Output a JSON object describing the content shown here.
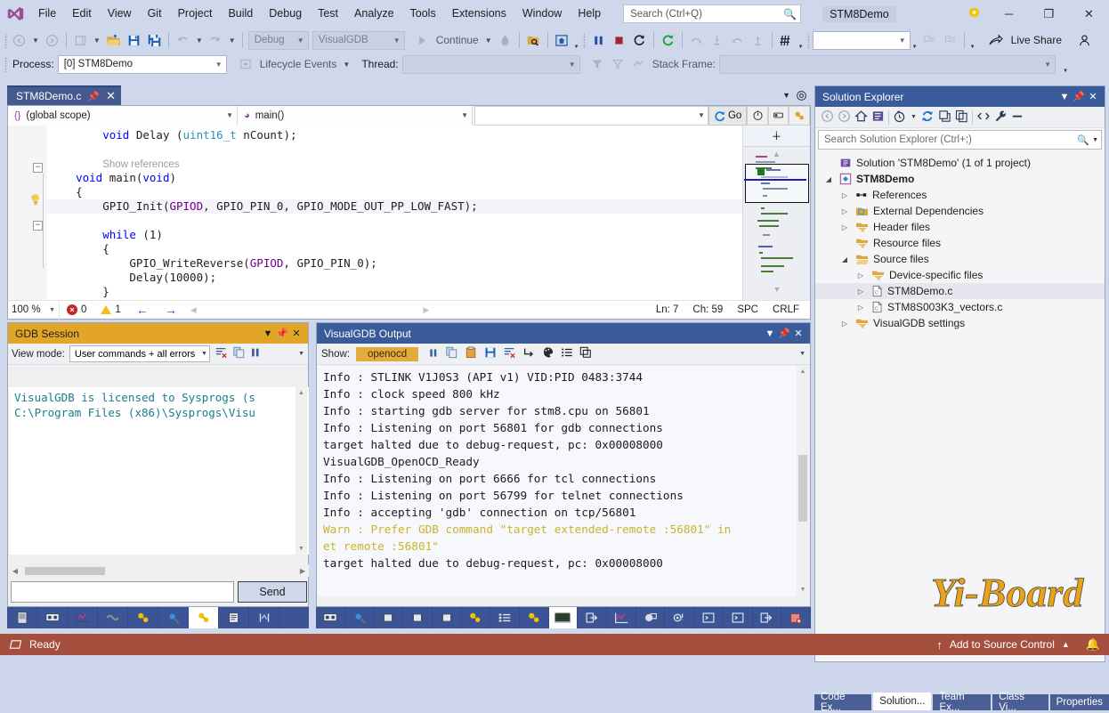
{
  "window": {
    "title": "STM8Demo",
    "menu": [
      "File",
      "Edit",
      "View",
      "Git",
      "Project",
      "Build",
      "Debug",
      "Test",
      "Analyze",
      "Tools",
      "Extensions",
      "Window",
      "Help"
    ],
    "search_placeholder": "Search (Ctrl+Q)",
    "minimize": "─",
    "restore": "❐",
    "close": "✕",
    "gear_icon": "gear-icon"
  },
  "toolbar": {
    "config": "Debug",
    "platform": "VisualGDB",
    "continue_label": "Continue",
    "live_share": "Live Share",
    "find_combo": ""
  },
  "debug_toolbar": {
    "process_label": "Process:",
    "process_value": "[0] STM8Demo",
    "lifecycle_label": "Lifecycle Events",
    "thread_label": "Thread:",
    "thread_value": "",
    "stack_frame_label": "Stack Frame:",
    "stack_frame_value": ""
  },
  "editor": {
    "tab_title": "STM8Demo.c",
    "scope": "(global scope)",
    "scope_icon": "{}",
    "member": "main()",
    "nav_search_value": "",
    "go_label": "Go",
    "code_lines": [
      {
        "indent": 4,
        "segments": [
          {
            "t": "void ",
            "c": "kw"
          },
          {
            "t": "Delay (",
            "c": ""
          },
          {
            "t": "uint16_t",
            "c": "ty"
          },
          {
            "t": " nCount);",
            "c": ""
          }
        ]
      },
      {
        "indent": 0,
        "segments": []
      },
      {
        "indent": 4,
        "segments": [
          {
            "t": "Show references",
            "c": "gray"
          }
        ]
      },
      {
        "indent": 2,
        "segments": [
          {
            "t": "void",
            "c": "kw"
          },
          {
            "t": " main(",
            "c": ""
          },
          {
            "t": "void",
            "c": "kw"
          },
          {
            "t": ")",
            "c": ""
          }
        ]
      },
      {
        "indent": 2,
        "segments": [
          {
            "t": "{",
            "c": ""
          }
        ]
      },
      {
        "indent": 4,
        "segments": [
          {
            "t": "GPIO_Init(",
            "c": ""
          },
          {
            "t": "GPIOD",
            "c": "mac"
          },
          {
            "t": ", GPIO_PIN_0, GPIO_MODE_OUT_PP_LOW_FAST);",
            "c": ""
          }
        ]
      },
      {
        "indent": 0,
        "segments": []
      },
      {
        "indent": 4,
        "segments": [
          {
            "t": "while",
            "c": "kw"
          },
          {
            "t": " (1)",
            "c": ""
          }
        ]
      },
      {
        "indent": 4,
        "segments": [
          {
            "t": "{",
            "c": ""
          }
        ]
      },
      {
        "indent": 6,
        "segments": [
          {
            "t": "GPIO_WriteReverse(",
            "c": ""
          },
          {
            "t": "GPIOD",
            "c": "mac"
          },
          {
            "t": ", GPIO_PIN_0);",
            "c": ""
          }
        ]
      },
      {
        "indent": 6,
        "segments": [
          {
            "t": "Delay(",
            "c": ""
          },
          {
            "t": "10000",
            "c": ""
          },
          {
            "t": ");",
            "c": ""
          }
        ]
      },
      {
        "indent": 4,
        "segments": [
          {
            "t": "}",
            "c": ""
          }
        ]
      },
      {
        "indent": 2,
        "segments": [
          {
            "t": "}",
            "c": ""
          }
        ]
      }
    ],
    "status": {
      "zoom": "100 %",
      "error_count": "0",
      "warning_count": "1",
      "line": "Ln: 7",
      "col": "Ch: 59",
      "spaces": "SPC",
      "eol": "CRLF"
    }
  },
  "gdb_session": {
    "title": "GDB Session",
    "view_mode_label": "View mode:",
    "view_mode_value": "User commands + all errors",
    "log": "VisualGDB is licensed to Sysprogs (s\nC:\\Program Files (x86)\\Sysprogs\\Visu",
    "input_value": "",
    "send_label": "Send"
  },
  "output": {
    "title": "VisualGDB Output",
    "show_label": "Show:",
    "show_value": "openocd",
    "lines": [
      {
        "text": "Info : STLINK V1J0S3 (API v1) VID:PID 0483:3744",
        "kind": "info"
      },
      {
        "text": "Info : clock speed 800 kHz",
        "kind": "info"
      },
      {
        "text": "Info : starting gdb server for stm8.cpu on 56801",
        "kind": "info"
      },
      {
        "text": "Info : Listening on port 56801 for gdb connections",
        "kind": "info"
      },
      {
        "text": "target halted due to debug-request, pc: 0x00008000",
        "kind": "info"
      },
      {
        "text": "VisualGDB_OpenOCD_Ready",
        "kind": "info"
      },
      {
        "text": "Info : Listening on port 6666 for tcl connections",
        "kind": "info"
      },
      {
        "text": "Info : Listening on port 56799 for telnet connections",
        "kind": "info"
      },
      {
        "text": "Info : accepting 'gdb' connection on tcp/56801",
        "kind": "info"
      },
      {
        "text": "Warn : Prefer GDB command \"target extended-remote :56801\" in",
        "kind": "warn"
      },
      {
        "text": "et remote :56801\"",
        "kind": "warn"
      },
      {
        "text": "target halted due to debug-request, pc: 0x00008000",
        "kind": "info"
      }
    ]
  },
  "solution_explorer": {
    "title": "Solution Explorer",
    "search_placeholder": "Search Solution Explorer (Ctrl+;)",
    "tree": [
      {
        "label": "Solution 'STM8Demo' (1 of 1 project)",
        "depth": 0,
        "twisty": "none",
        "icon": "solution-icon",
        "bold": false,
        "selected": false
      },
      {
        "label": "STM8Demo",
        "depth": 0,
        "twisty": "open",
        "icon": "project-icon",
        "bold": true,
        "selected": false
      },
      {
        "label": "References",
        "depth": 1,
        "twisty": "closed",
        "icon": "references-icon",
        "bold": false,
        "selected": false
      },
      {
        "label": "External Dependencies",
        "depth": 1,
        "twisty": "closed",
        "icon": "ext-deps-icon",
        "bold": false,
        "selected": false
      },
      {
        "label": "Header files",
        "depth": 1,
        "twisty": "closed",
        "icon": "filter-folder-icon",
        "bold": false,
        "selected": false
      },
      {
        "label": "Resource files",
        "depth": 1,
        "twisty": "none",
        "icon": "filter-folder-icon",
        "bold": false,
        "selected": false
      },
      {
        "label": "Source files",
        "depth": 1,
        "twisty": "open",
        "icon": "filter-folder-open-icon",
        "bold": false,
        "selected": false
      },
      {
        "label": "Device-specific files",
        "depth": 2,
        "twisty": "closed",
        "icon": "filter-folder-icon",
        "bold": false,
        "selected": false
      },
      {
        "label": "STM8Demo.c",
        "depth": 2,
        "twisty": "closed",
        "icon": "c-file-icon",
        "bold": false,
        "selected": true
      },
      {
        "label": "STM8S003K3_vectors.c",
        "depth": 2,
        "twisty": "closed",
        "icon": "c-file-icon",
        "bold": false,
        "selected": false
      },
      {
        "label": "VisualGDB settings",
        "depth": 1,
        "twisty": "closed",
        "icon": "filter-folder-icon",
        "bold": false,
        "selected": false
      }
    ]
  },
  "bottom_tabs": [
    {
      "label": "Code Ex...",
      "active": false
    },
    {
      "label": "Solution...",
      "active": true
    },
    {
      "label": "Team Ex...",
      "active": false
    },
    {
      "label": "Class Vi...",
      "active": false
    },
    {
      "label": "Properties",
      "active": false
    }
  ],
  "statusbar": {
    "ready": "Ready",
    "source_control": "Add to Source Control",
    "notifications_icon": "bell-icon"
  },
  "watermark": {
    "text": "Yi-Board"
  },
  "colors": {
    "chrome": "#cfd7ea",
    "accent_blue": "#3a5b9a",
    "amber": "#e3a528",
    "status_red": "#a5503f",
    "keyword": "#0000ff",
    "type": "#2b91af",
    "macro": "#6f008a",
    "gdb_text": "#1b7b8c",
    "warn_text": "#c8b42e"
  }
}
